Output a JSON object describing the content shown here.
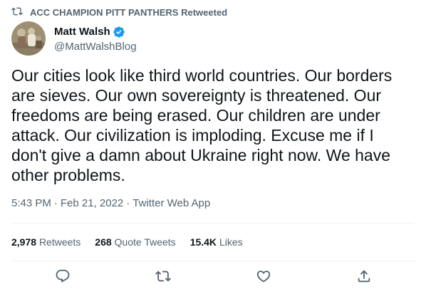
{
  "retweet_context": {
    "text": "ACC CHAMPION PITT PANTHERS Retweeted",
    "icon": "retweet-icon"
  },
  "author": {
    "display_name": "Matt Walsh",
    "handle": "@MattWalshBlog",
    "verified": true,
    "verified_color": "#1d9bf0"
  },
  "tweet": {
    "text": "Our cities look like third world countries. Our borders\nare sieves. Our own sovereignty is threatened. Our\nfreedoms are being erased. Our children are under\nattack. Our civilization is imploding. Excuse me if I\ndon't give a damn about Ukraine right now. We have\nother problems."
  },
  "meta": {
    "time": "5:43 PM",
    "date": "Feb 21, 2022",
    "source": "Twitter Web App",
    "separator": "·"
  },
  "stats": {
    "retweets": {
      "count": "2,978",
      "label": "Retweets"
    },
    "quote_tweets": {
      "count": "268",
      "label": "Quote Tweets"
    },
    "likes": {
      "count": "15.4K",
      "label": "Likes"
    }
  },
  "actions": [
    "reply-icon",
    "retweet-icon",
    "like-icon",
    "share-icon"
  ],
  "colors": {
    "text": "#0f1419",
    "secondary": "#536471",
    "divider": "#eff3f4",
    "accent": "#1d9bf0"
  }
}
